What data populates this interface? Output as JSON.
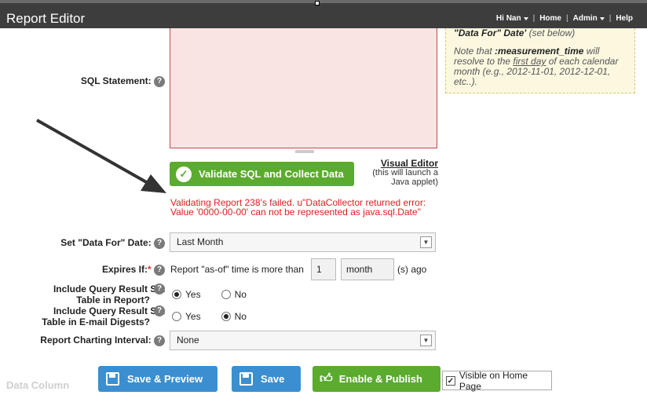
{
  "app": {
    "title": "Report Editor"
  },
  "nav": {
    "user": "Hi Nan",
    "home": "Home",
    "admin": "Admin",
    "help": "Help"
  },
  "note": {
    "line1_bold": "\"Data For\" Date'",
    "line1_rest": " (set below)",
    "p2_a": "Note that ",
    "p2_bold": ":measurement_time",
    "p2_b": " will resolve to the ",
    "p2_u": "first day",
    "p2_c": " of each calendar month (e.g., 2012-11-01, 2012-12-01, etc..)."
  },
  "sql": {
    "label": "SQL Statement:",
    "value": ""
  },
  "validate": {
    "label": "Validate SQL and Collect Data"
  },
  "visual_editor": {
    "link": "Visual Editor",
    "sub": "(this will launch a Java applet)"
  },
  "error": {
    "text": "Validating Report 238's failed. u\"DataCollector returned error: Value '0000-00-00' can not be represented as java.sql.Date\""
  },
  "data_for": {
    "label": "Set \"Data For\" Date:",
    "value": "Last Month"
  },
  "expires": {
    "label": "Expires If:",
    "required": "*",
    "prefix": "Report \"as-of\" time is more than",
    "number": "1",
    "unit": "month",
    "suffix": "(s) ago"
  },
  "include_report": {
    "label_l1": "Include Query Result Set",
    "label_l2": "Table in Report?",
    "yes": "Yes",
    "no": "No",
    "selected": "Yes"
  },
  "include_digest": {
    "label_l1": "Include Query Result Set",
    "label_l2": "Table in E-mail Digests?",
    "yes": "Yes",
    "no": "No",
    "selected": "No"
  },
  "charting": {
    "label": "Report Charting Interval:",
    "value": "None"
  },
  "buttons": {
    "save_preview": "Save & Preview",
    "save": "Save",
    "enable_publish": "Enable & Publish"
  },
  "visible": {
    "label": "Visible on Home Page",
    "checked": true
  },
  "faded": {
    "text": "Data Column"
  },
  "help_glyph": "?",
  "colors": {
    "green": "#5aab2e",
    "blue": "#3b8fd0",
    "error": "#e02020",
    "topbar": "#3d3d3d"
  }
}
